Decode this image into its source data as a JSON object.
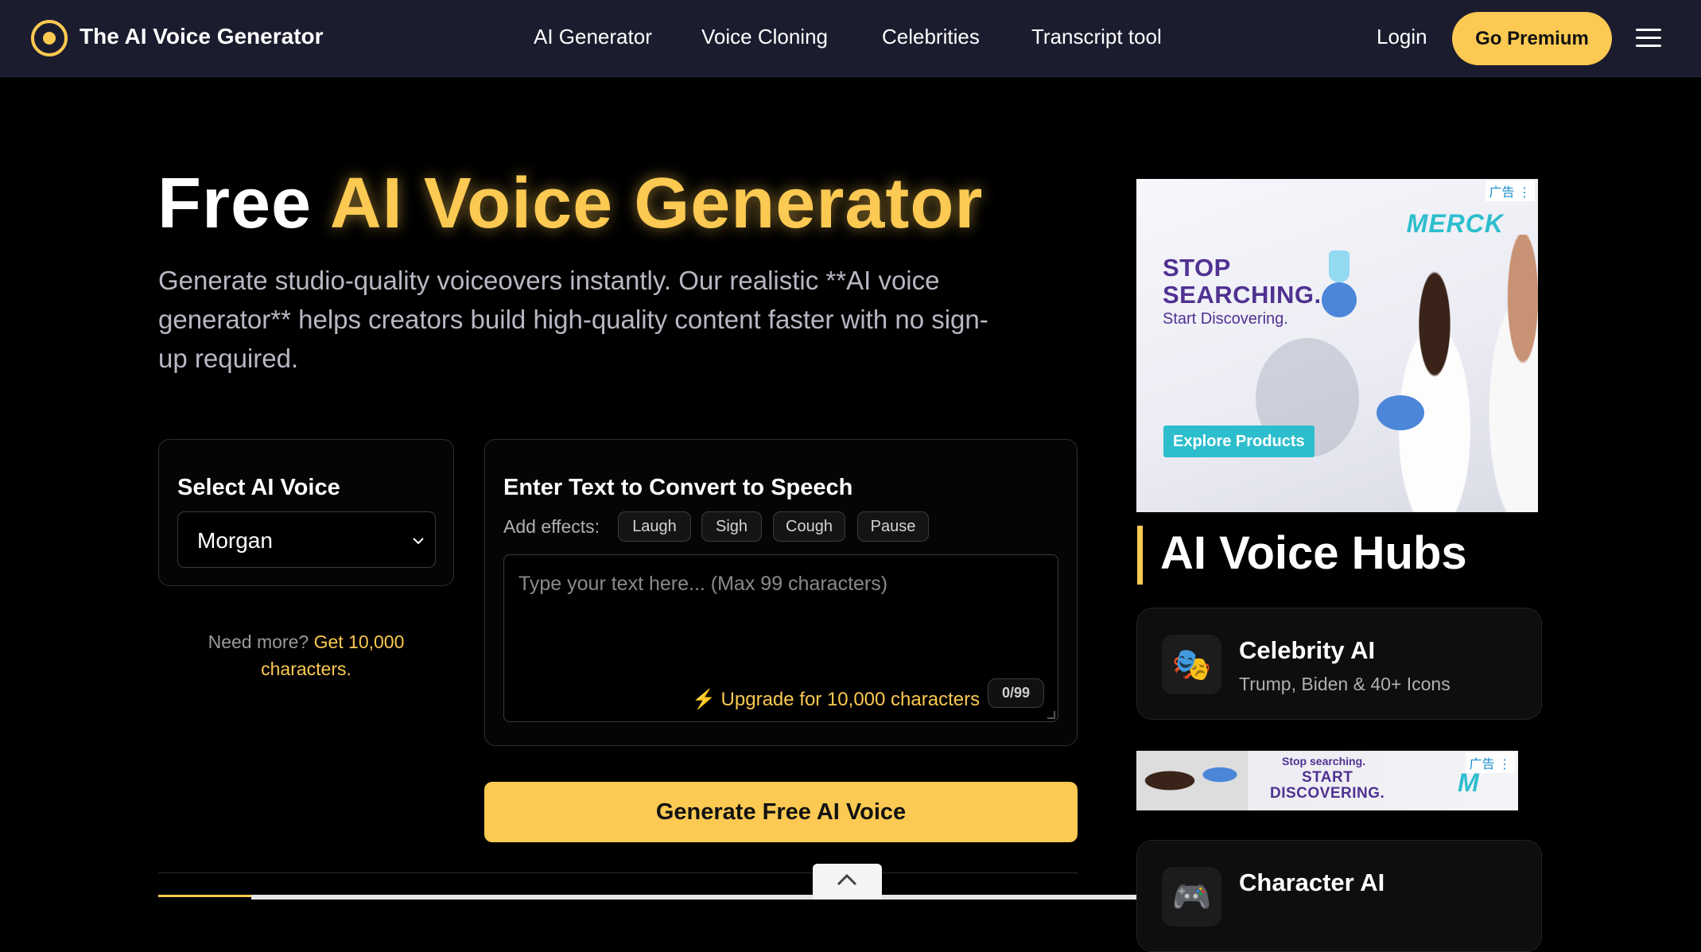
{
  "nav": {
    "brand": "The AI Voice Generator",
    "links": [
      "AI Generator",
      "Voice Cloning",
      "Celebrities",
      "Transcript tool"
    ],
    "login": "Login",
    "premium": "Go Premium",
    "menu_icon": "hamburger-icon"
  },
  "hero": {
    "title_plain": "Free",
    "title_accent": "AI Voice Generator",
    "subtitle": "Generate studio-quality voiceovers instantly. Our realistic **AI voice generator** helps creators build high-quality content faster with no sign-up required."
  },
  "voice_panel": {
    "title": "Select AI Voice",
    "selected_voice": "Morgan",
    "need_more": "Need more?",
    "need_more_link": "Get 10,000 characters."
  },
  "text_panel": {
    "title": "Enter Text to Convert to Speech",
    "effects_label": "Add effects:",
    "effects": [
      "Laugh",
      "Sigh",
      "Cough",
      "Pause"
    ],
    "placeholder": "Type your text here... (Max 99 characters)",
    "upgrade": "⚡ Upgrade for 10,000 characters",
    "counter": "0/99"
  },
  "generate_button": "Generate Free AI Voice",
  "ads": {
    "label": "广告 ⋮",
    "ad1": {
      "brand": "MERCK",
      "headline_1": "STOP",
      "headline_2": "SEARCHING.",
      "subline": "Start Discovering.",
      "cta": "Explore Products"
    },
    "ad2": {
      "small": "Stop searching.",
      "big_1": "START",
      "big_2": "DISCOVERING.",
      "logo": "M"
    }
  },
  "hubs": {
    "title": "AI Voice Hubs",
    "items": [
      {
        "name": "Celebrity AI",
        "desc": "Trump, Biden & 40+ Icons",
        "icon": "🎭"
      },
      {
        "name": "Character AI",
        "desc": "",
        "icon": "🎮"
      }
    ]
  },
  "colors": {
    "accent": "#fcc952",
    "nav_bg": "#1b1c2e",
    "page_bg": "#000000",
    "ad_purple": "#503291",
    "ad_teal": "#2dbecd"
  }
}
